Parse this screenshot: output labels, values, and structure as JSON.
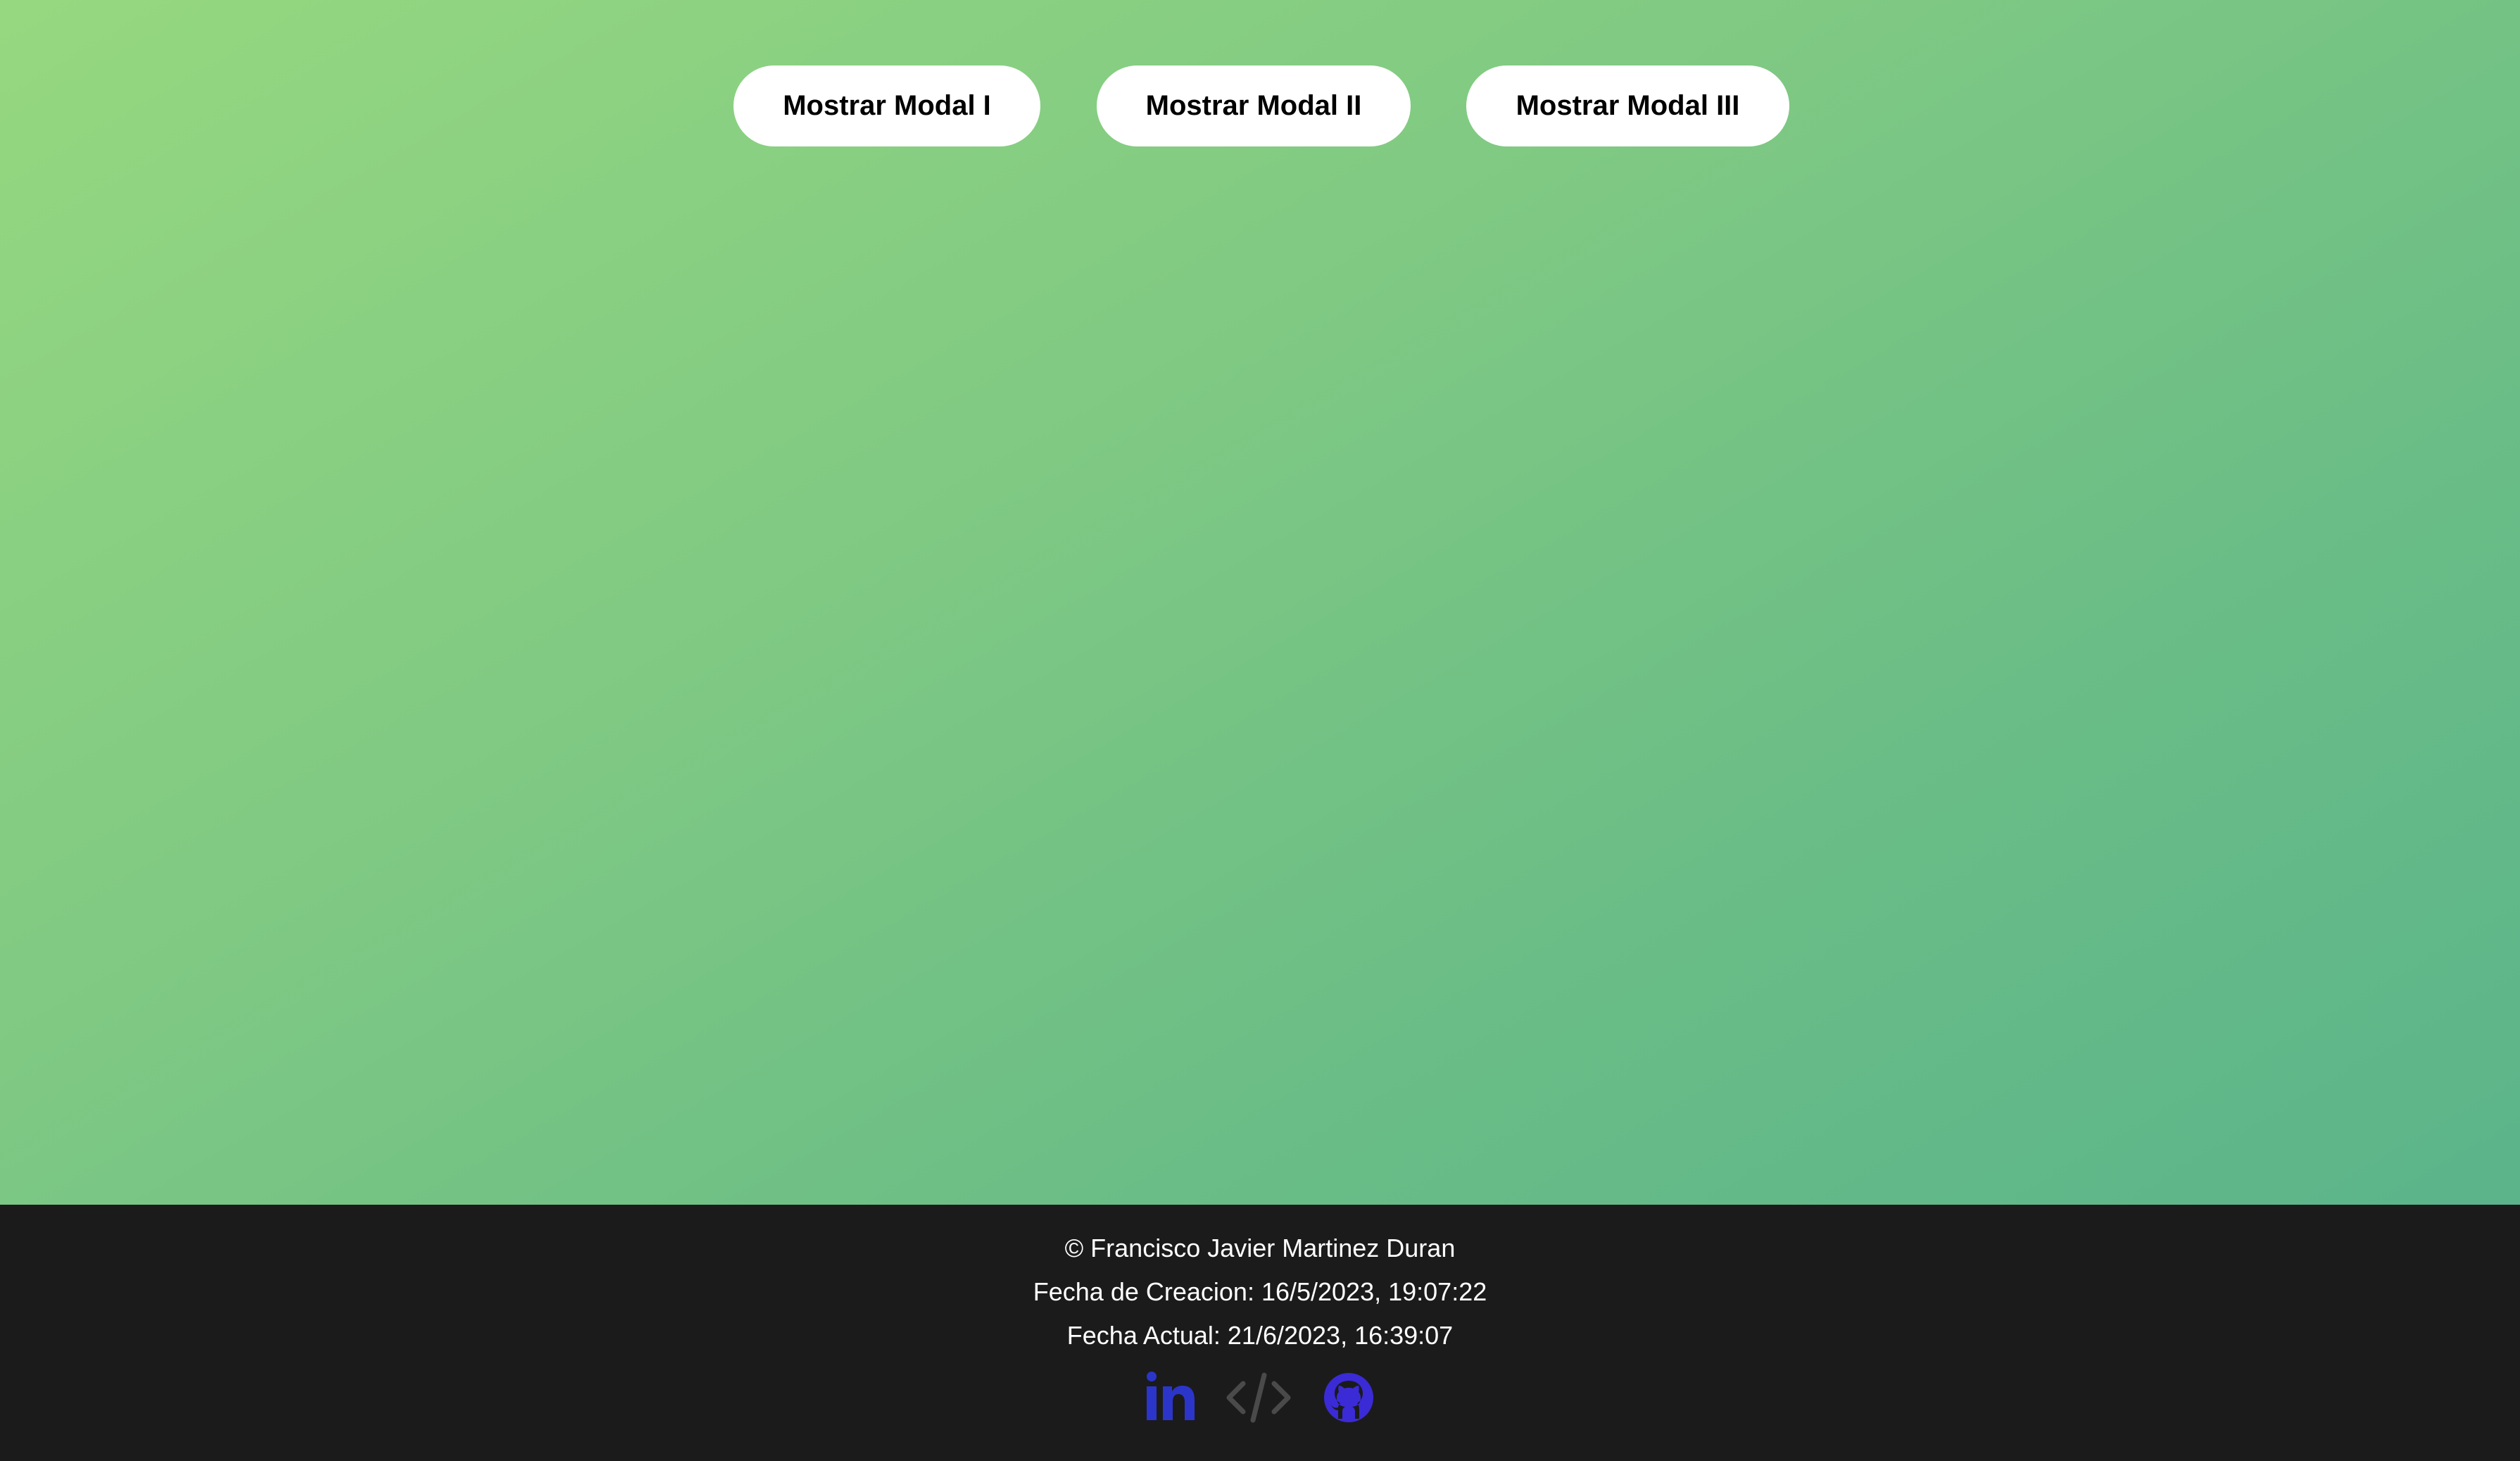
{
  "buttons": {
    "modal_1_label": "Mostrar Modal I",
    "modal_2_label": "Mostrar Modal II",
    "modal_3_label": "Mostrar Modal III"
  },
  "footer": {
    "copyright": "© Francisco Javier Martinez Duran",
    "created": "Fecha de Creacion: 16/5/2023, 19:07:22",
    "current": "Fecha Actual: 21/6/2023, 16:39:07",
    "social": [
      {
        "icon": "linkedin-icon",
        "color": "#2b35c9"
      },
      {
        "icon": "code-icon",
        "color": "#4a4a4a"
      },
      {
        "icon": "github-icon",
        "color": "#3a2bd6"
      }
    ]
  },
  "colors": {
    "gradient_start": "#96d880",
    "gradient_end": "#5bb48a",
    "footer_bg": "#1b1b1b",
    "button_bg": "#ffffff"
  }
}
